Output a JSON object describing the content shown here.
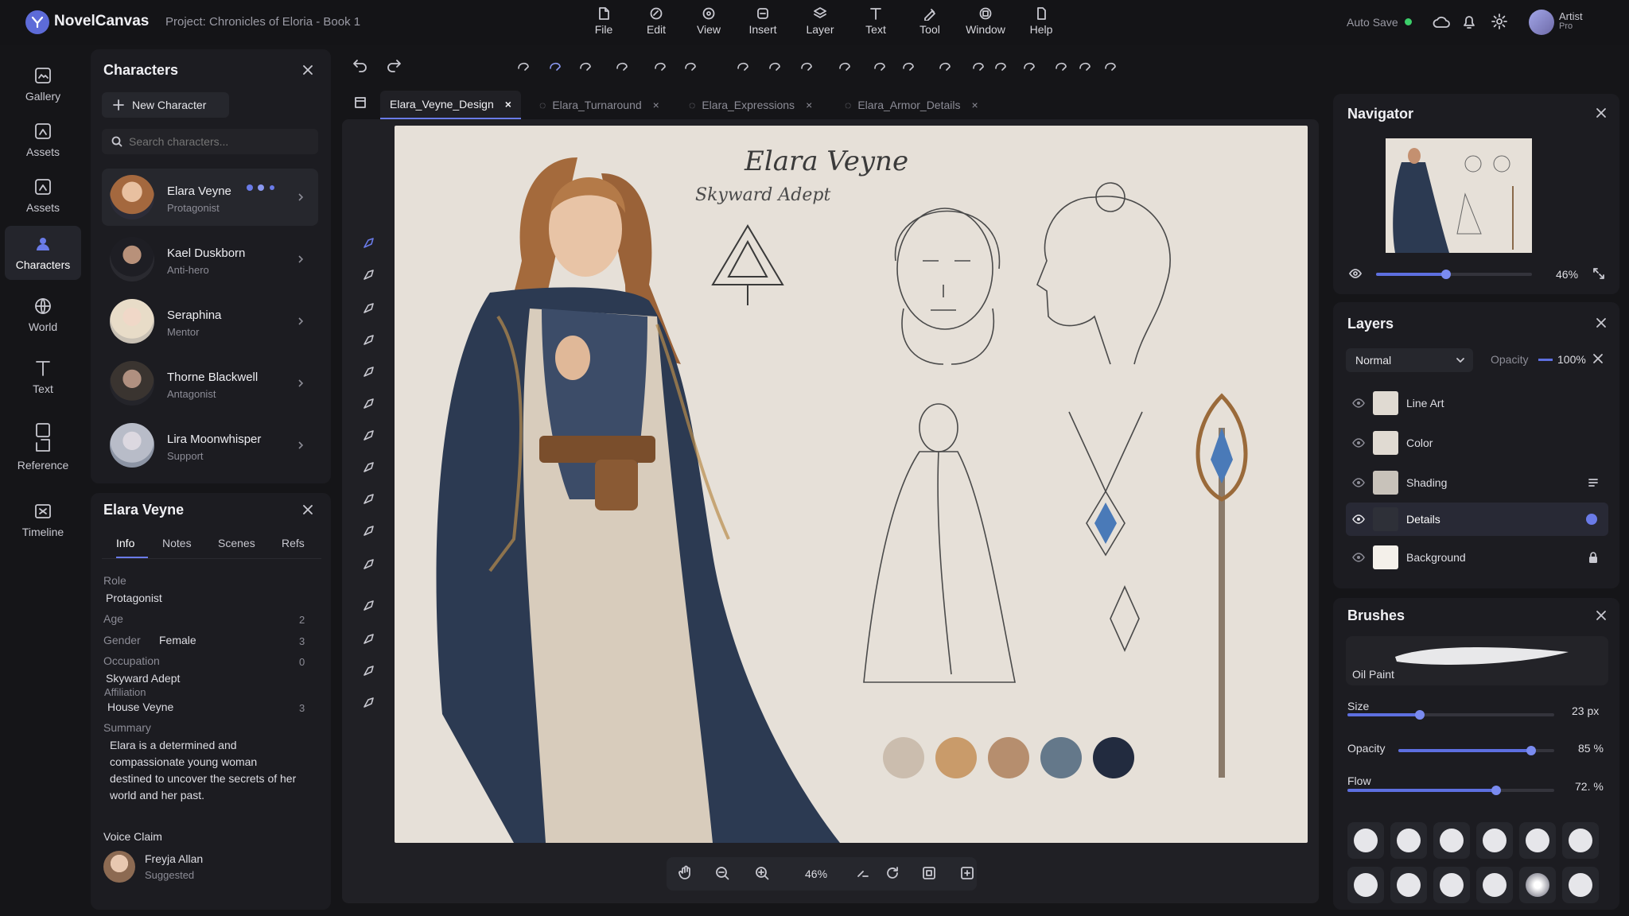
{
  "app": {
    "name": "NovelCanvas",
    "project": "Project: Chronicles of Eloria - Book 1"
  },
  "menu": [
    {
      "label": "File",
      "icon": "file-icon"
    },
    {
      "label": "Edit",
      "icon": "edit-icon"
    },
    {
      "label": "View",
      "icon": "view-icon"
    },
    {
      "label": "Insert",
      "icon": "insert-icon"
    },
    {
      "label": "Layer",
      "icon": "layer-icon"
    },
    {
      "label": "Text",
      "icon": "text-icon"
    },
    {
      "label": "Tool",
      "icon": "tool-icon"
    },
    {
      "label": "Window",
      "icon": "window-icon"
    },
    {
      "label": "Help",
      "icon": "help-icon"
    }
  ],
  "status": {
    "autosave": "Auto Save",
    "user_name": "Artist",
    "user_plan": "Pro",
    "autosave_color": "#3ccf6a"
  },
  "rail": [
    {
      "label": "Gallery",
      "icon": "gallery-icon"
    },
    {
      "label": "Assets",
      "icon": "assets-icon"
    },
    {
      "label": "Assets",
      "icon": "assets-icon"
    },
    {
      "label": "Characters",
      "icon": "characters-icon"
    },
    {
      "label": "World",
      "icon": "world-icon"
    },
    {
      "label": "Text",
      "icon": "text-icon"
    },
    {
      "label": "Reference",
      "icon": "reference-icon"
    },
    {
      "label": "Timeline",
      "icon": "timeline-icon"
    }
  ],
  "characters": {
    "title": "Characters",
    "new_button": "New Character",
    "search_placeholder": "Search characters...",
    "list": [
      {
        "name": "Elara Veyne",
        "role": "Protagonist"
      },
      {
        "name": "Kael Duskborn",
        "role": "Anti-hero"
      },
      {
        "name": "Seraphina",
        "role": "Mentor"
      },
      {
        "name": "Thorne Blackwell",
        "role": "Antagonist"
      },
      {
        "name": "Lira Moonwhisper",
        "role": "Support"
      }
    ]
  },
  "details": {
    "title": "Elara Veyne",
    "tabs": [
      "Info",
      "Notes",
      "Scenes",
      "Refs"
    ],
    "role_label": "Role",
    "role": "Protagonist",
    "age_label": "Age",
    "age_num": "2",
    "gender_label": "Gender",
    "gender": "Female",
    "gender_num": "3",
    "occupation_label": "Occupation",
    "occupation": "Skyward Adept",
    "occupation_num": "0",
    "affiliation_label": "Affiliation",
    "affiliation": "House Veyne",
    "affiliation_num": "3",
    "summary_label": "Summary",
    "summary": "Elara is a determined and compassionate young woman destined to uncover the secrets of her world and her past.",
    "voice_label": "Voice Claim",
    "voice_name": "Freyja Allan",
    "voice_status": "Suggested"
  },
  "doc_tabs": [
    "Elara_Veyne_Design",
    "Elara_Turnaround",
    "Elara_Expressions",
    "Elara_Armor_Details"
  ],
  "art": {
    "title": "Elara Veyne",
    "subtitle": "Skyward Adept",
    "palette": [
      "#cbbdae",
      "#c99b6a",
      "#b68e6e",
      "#64788a",
      "#222b3f"
    ]
  },
  "zoom": "46%",
  "navigator": {
    "title": "Navigator",
    "zoom": "46%",
    "slider": 0.45
  },
  "layers": {
    "title": "Layers",
    "blend": "Normal",
    "opacity_label": "Opacity",
    "opacity": "100%",
    "items": [
      "Line Art",
      "Color",
      "Shading",
      "Details",
      "Background"
    ]
  },
  "brushes": {
    "title": "Brushes",
    "name": "Oil Paint",
    "size_label": "Size",
    "size": "23 px",
    "size_frac": 0.35,
    "opacity_label": "Opacity",
    "opacity": "85 %",
    "opacity_frac": 0.85,
    "flow_label": "Flow",
    "flow": "72. %",
    "flow_frac": 0.72
  }
}
